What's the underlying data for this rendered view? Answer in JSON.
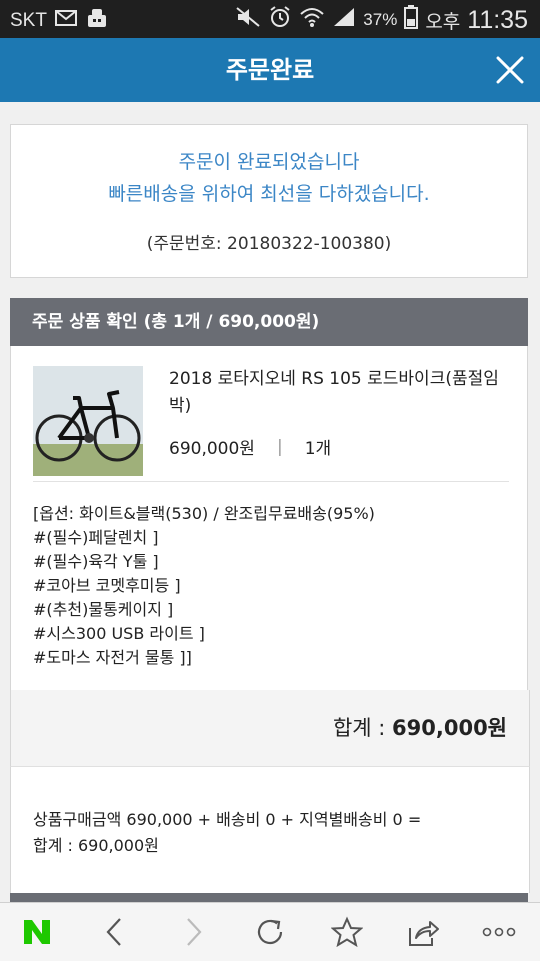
{
  "statusbar": {
    "carrier": "SKT",
    "battery": "37%",
    "ampm": "오후",
    "time": "11:35"
  },
  "appbar": {
    "title": "주문완료",
    "close_icon": "close-icon"
  },
  "completion": {
    "line1": "주문이 완료되었습니다",
    "line2": "빠른배송을 위하여 최선을 다하겠습니다.",
    "order_number": "(주문번호: 20180322-100380)"
  },
  "section": {
    "header": "주문 상품 확인 (총 1개 / 690,000원)"
  },
  "product": {
    "name": "2018 로타지오네 RS 105 로드바이크(품절임박)",
    "price": "690,000원",
    "qty": "1개",
    "options": [
      "[옵션: 화이트&블랙(530) / 완조립무료배송(95%)",
      "#(필수)페달렌치 ]",
      "#(필수)육각 Y툴 ]",
      "#코아브 코멧후미등 ]",
      "#(추천)물통케이지 ]",
      "#시스300 USB 라이트 ]",
      "#도마스 자전거 물통 ]]"
    ]
  },
  "total": {
    "label": "합계 :",
    "value": "690,000원"
  },
  "calculation": {
    "line1": "상품구매금액 690,000 + 배송비 0 + 지역별배송비 0 =",
    "line2": "합계 : 690,000원"
  },
  "bottom_nav": {
    "logo": "N",
    "brand_color": "#1ec800",
    "items": [
      "naver-logo",
      "back-icon",
      "forward-icon",
      "refresh-icon",
      "star-icon",
      "share-icon",
      "more-icon"
    ]
  },
  "colors": {
    "appbar": "#1d78b2",
    "accent_text": "#3b86c6",
    "section_header": "#6a6d74"
  }
}
